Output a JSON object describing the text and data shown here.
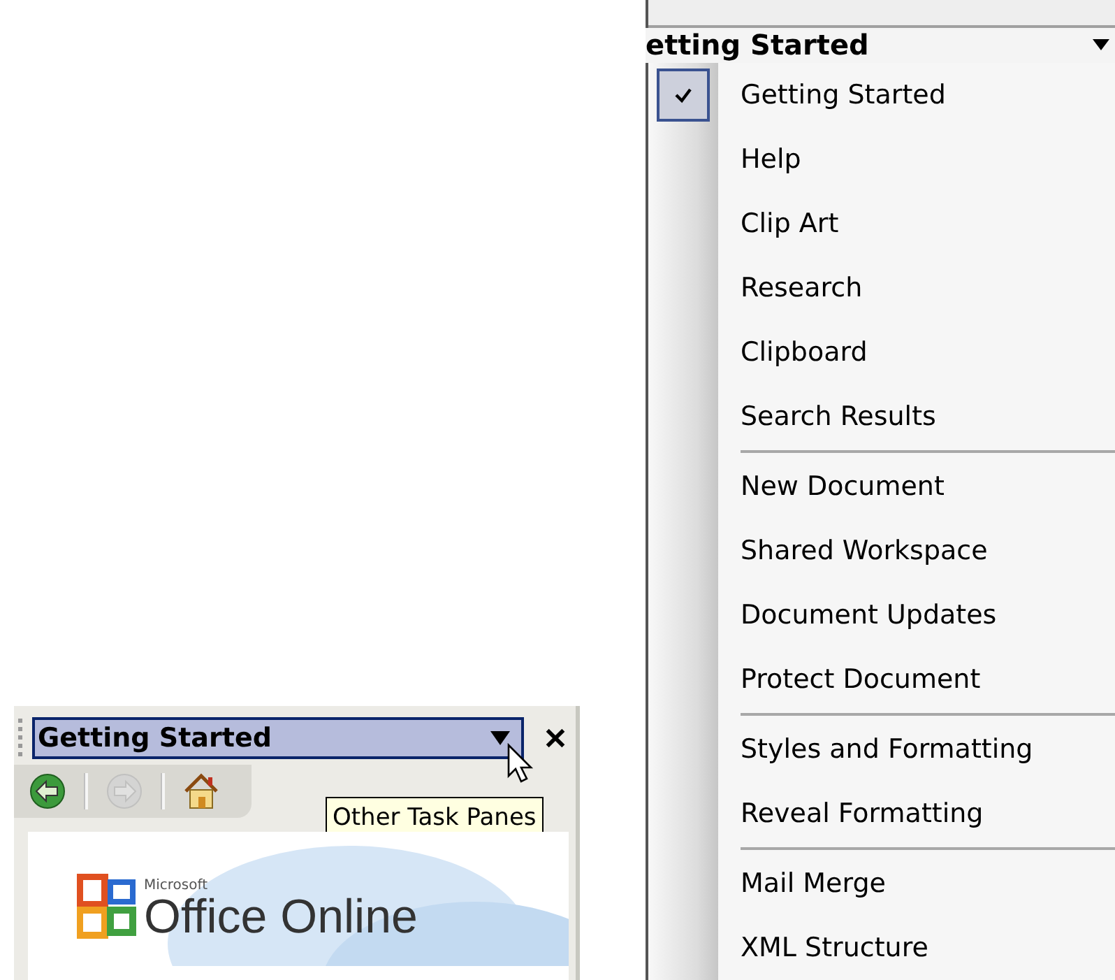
{
  "task_pane": {
    "title": "Getting Started",
    "tooltip": "Other Task Panes",
    "toolbar": [
      {
        "kind": "back",
        "disabled": false
      },
      {
        "kind": "forward",
        "disabled": true
      },
      {
        "kind": "home",
        "disabled": false
      }
    ],
    "logo": {
      "brand": "Microsoft",
      "product": "Office Online"
    }
  },
  "menu": {
    "title": "etting Started",
    "groups": [
      {
        "items": [
          {
            "label": "Getting Started",
            "checked": true
          },
          {
            "label": "Help",
            "checked": false
          },
          {
            "label": "Clip Art",
            "checked": false
          },
          {
            "label": "Research",
            "checked": false
          },
          {
            "label": "Clipboard",
            "checked": false
          },
          {
            "label": "Search Results",
            "checked": false
          }
        ]
      },
      {
        "items": [
          {
            "label": "New Document",
            "checked": false
          },
          {
            "label": "Shared Workspace",
            "checked": false
          },
          {
            "label": "Document Updates",
            "checked": false
          },
          {
            "label": "Protect Document",
            "checked": false
          }
        ]
      },
      {
        "items": [
          {
            "label": "Styles and Formatting",
            "checked": false
          },
          {
            "label": "Reveal Formatting",
            "checked": false
          }
        ]
      },
      {
        "items": [
          {
            "label": "Mail Merge",
            "checked": false
          },
          {
            "label": "XML Structure",
            "checked": false
          }
        ]
      }
    ]
  }
}
